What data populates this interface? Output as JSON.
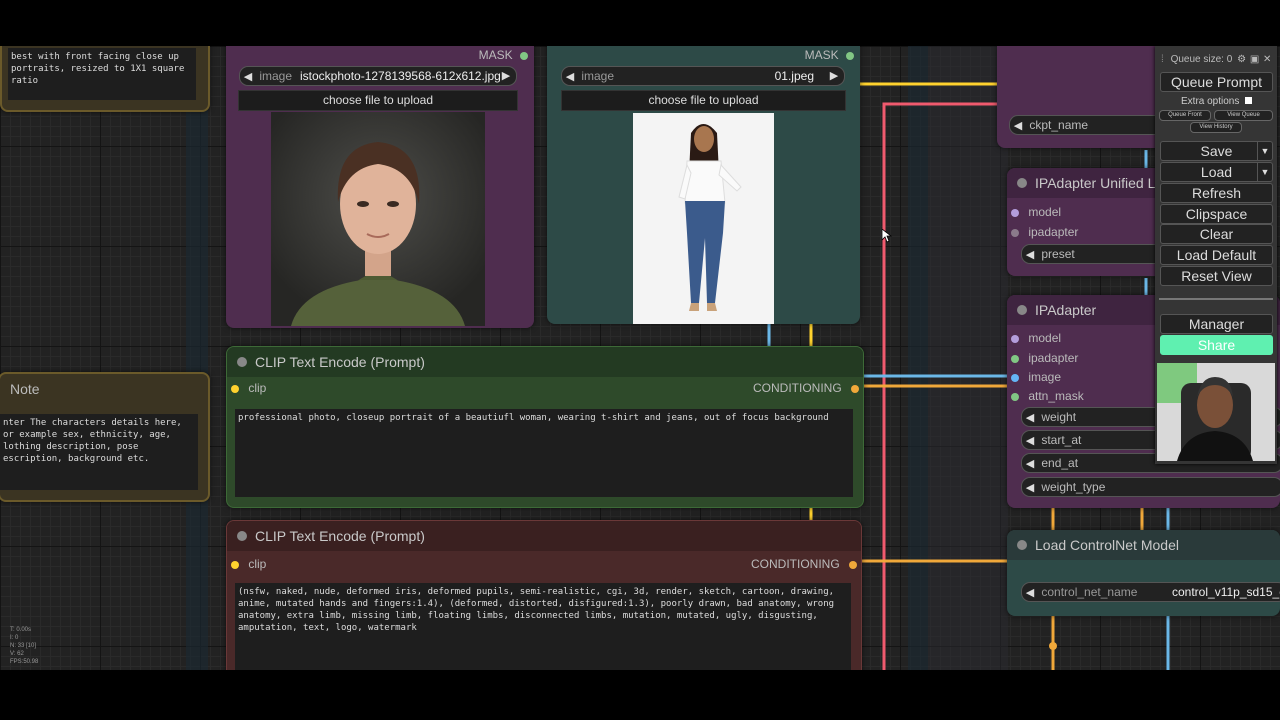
{
  "left_note_top": {
    "text": "best with front facing close up\nportraits, resized to 1X1 square\nratio"
  },
  "left_note": {
    "title": "Note",
    "text": "nter The characters details here,\nor example sex, ethnicity, age,\nlothing description, pose\nescription, background etc."
  },
  "load_image_1": {
    "mask_label": "MASK",
    "image_label": "image",
    "image_value": "istockphoto-1278139568-612x612.jpg",
    "upload_label": "choose file to upload"
  },
  "load_image_2": {
    "mask_label": "MASK",
    "image_label": "image",
    "image_value": "01.jpeg",
    "upload_label": "choose file to upload"
  },
  "clip_pos": {
    "title": "CLIP Text Encode (Prompt)",
    "input": "clip",
    "output": "CONDITIONING",
    "text": "professional photo, closeup portrait of a beautiufl woman, wearing t-shirt and jeans, out of focus background"
  },
  "clip_neg": {
    "title": "CLIP Text Encode (Prompt)",
    "input": "clip",
    "output": "CONDITIONING",
    "text": "(nsfw, naked, nude, deformed iris, deformed pupils, semi-realistic, cgi, 3d, render, sketch, cartoon, drawing,\nanime, mutated hands and fingers:1.4), (deformed, distorted, disfigured:1.3), poorly drawn, bad anatomy, wrong\nanatomy, extra limb, missing limb, floating limbs, disconnected limbs, mutation, mutated, ugly, disgusting,\namputation, text, logo, watermark"
  },
  "checkpoint": {
    "widget": "ckpt_name"
  },
  "ipadapter_unified": {
    "title": "IPAdapter Unified Lo",
    "inputs": [
      "model",
      "ipadapter"
    ],
    "widget": "preset"
  },
  "ipadapter": {
    "title": "IPAdapter",
    "inputs": [
      "model",
      "ipadapter",
      "image",
      "attn_mask"
    ],
    "widgets": [
      "weight",
      "start_at",
      "end_at",
      "weight_type"
    ]
  },
  "controlnet": {
    "title": "Load ControlNet Model",
    "widget_label": "control_net_name",
    "widget_value": "control_v11p_sd15_c"
  },
  "menu": {
    "queue_size": "Queue size: 0",
    "queue_prompt": "Queue Prompt",
    "extra_options": "Extra options",
    "queue_front": "Queue Front",
    "view_queue": "View Queue",
    "view_history": "View History",
    "save": "Save",
    "load": "Load",
    "refresh": "Refresh",
    "clipspace": "Clipspace",
    "clear": "Clear",
    "load_default": "Load Default",
    "reset_view": "Reset View",
    "manager": "Manager",
    "share": "Share"
  },
  "stats": {
    "t": "T: 0.00s",
    "i": "I: 0",
    "n": "N: 33 [10]",
    "v": "V: 62",
    "fps": "FPS:50.98"
  },
  "colors": {
    "purple_node": "#4f2d4f",
    "teal_node": "#2d4a47",
    "green_node": "#2e4a2a",
    "red_node": "#4a2929",
    "note_node": "#3b3422",
    "wire_yellow": "#ffd22e",
    "wire_blue": "#6bb8e8",
    "wire_pink": "#f05a6e",
    "wire_orange": "#f0a83a",
    "share_bg": "#5ff0b0"
  }
}
